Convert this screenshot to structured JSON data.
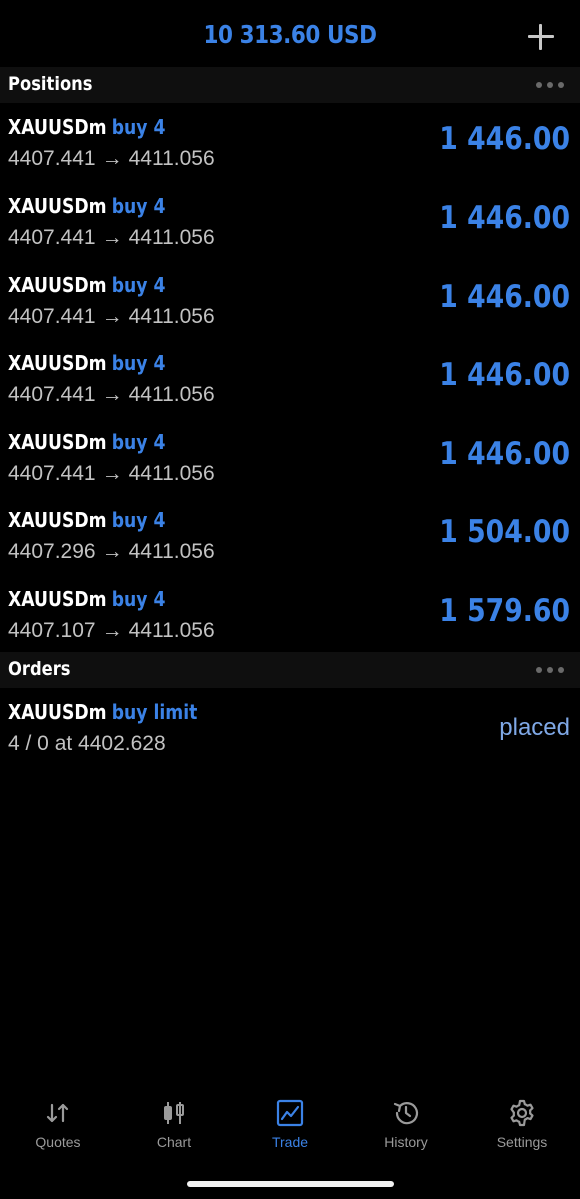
{
  "header": {
    "balance": "10 313.60 USD",
    "add_icon": "plus-icon"
  },
  "positions": {
    "title": "Positions",
    "menu_icon": "more-dots-icon",
    "items": [
      {
        "symbol": "XAUUSDm",
        "side": "buy 4",
        "open": "4407.441",
        "arrow": "→",
        "current": "4411.056",
        "profit": "1 446.00"
      },
      {
        "symbol": "XAUUSDm",
        "side": "buy 4",
        "open": "4407.441",
        "arrow": "→",
        "current": "4411.056",
        "profit": "1 446.00"
      },
      {
        "symbol": "XAUUSDm",
        "side": "buy 4",
        "open": "4407.441",
        "arrow": "→",
        "current": "4411.056",
        "profit": "1 446.00"
      },
      {
        "symbol": "XAUUSDm",
        "side": "buy 4",
        "open": "4407.441",
        "arrow": "→",
        "current": "4411.056",
        "profit": "1 446.00"
      },
      {
        "symbol": "XAUUSDm",
        "side": "buy 4",
        "open": "4407.441",
        "arrow": "→",
        "current": "4411.056",
        "profit": "1 446.00"
      },
      {
        "symbol": "XAUUSDm",
        "side": "buy 4",
        "open": "4407.296",
        "arrow": "→",
        "current": "4411.056",
        "profit": "1 504.00"
      },
      {
        "symbol": "XAUUSDm",
        "side": "buy 4",
        "open": "4407.107",
        "arrow": "→",
        "current": "4411.056",
        "profit": "1 579.60"
      }
    ]
  },
  "orders": {
    "title": "Orders",
    "menu_icon": "more-dots-icon",
    "items": [
      {
        "symbol": "XAUUSDm",
        "side": "buy limit",
        "details": "4 / 0 at 4402.628",
        "status": "placed"
      }
    ]
  },
  "tabbar": {
    "tabs": [
      {
        "label": "Quotes",
        "icon": "quotes-arrows-icon",
        "active": false
      },
      {
        "label": "Chart",
        "icon": "candlestick-chart-icon",
        "active": false
      },
      {
        "label": "Trade",
        "icon": "trade-chart-icon",
        "active": true
      },
      {
        "label": "History",
        "icon": "history-clock-icon",
        "active": false
      },
      {
        "label": "Settings",
        "icon": "gear-icon",
        "active": false
      }
    ]
  },
  "colors": {
    "accent": "#3b82e6",
    "background": "#000000",
    "section_background": "#0f0f0f",
    "secondary_text": "#c2c2c2",
    "tab_inactive": "#9a9a9a"
  }
}
